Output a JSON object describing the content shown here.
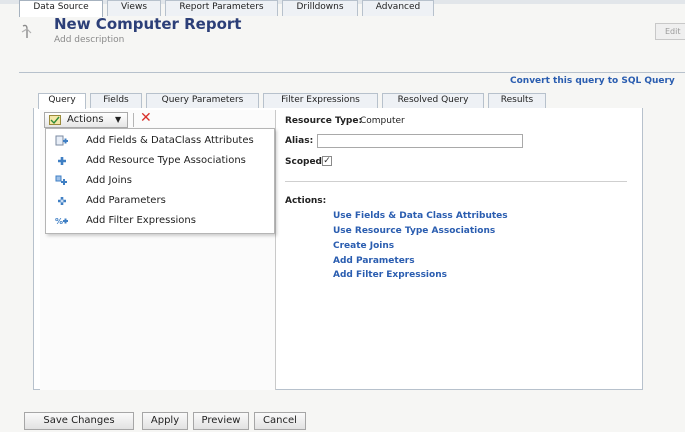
{
  "header": {
    "title": "New Computer Report",
    "description_placeholder": "Add description",
    "edit_label": "Edit"
  },
  "outer_tabs": [
    {
      "label": "Data Source",
      "active": true
    },
    {
      "label": "Views",
      "active": false
    },
    {
      "label": "Report Parameters",
      "active": false
    },
    {
      "label": "Drilldowns",
      "active": false
    },
    {
      "label": "Advanced",
      "active": false
    }
  ],
  "convert_link": "Convert this query to SQL Query",
  "inner_tabs": [
    {
      "label": "Query",
      "active": true
    },
    {
      "label": "Fields",
      "active": false
    },
    {
      "label": "Query Parameters",
      "active": false
    },
    {
      "label": "Filter Expressions",
      "active": false
    },
    {
      "label": "Resolved Query",
      "active": false
    },
    {
      "label": "Results",
      "active": false
    }
  ],
  "toolbar": {
    "actions_label": "Actions",
    "actions_icon": "actions-icon",
    "delete_icon": "delete-x-icon"
  },
  "actions_menu": [
    {
      "label": "Add Fields & DataClass Attributes",
      "icon": "fields-icon"
    },
    {
      "label": "Add Resource Type Associations",
      "icon": "association-icon"
    },
    {
      "label": "Add Joins",
      "icon": "joins-icon"
    },
    {
      "label": "Add Parameters",
      "icon": "parameters-icon"
    },
    {
      "label": "Add Filter Expressions",
      "icon": "filter-icon"
    }
  ],
  "details": {
    "resource_type_label": "Resource Type:",
    "resource_type_value": "Computer",
    "alias_label": "Alias:",
    "alias_value": "",
    "scoped_label": "Scoped:",
    "scoped_checked": true,
    "actions_heading": "Actions:",
    "action_links": [
      "Use Fields & Data Class Attributes",
      "Use Resource Type Associations",
      "Create Joins",
      "Add Parameters",
      "Add Filter Expressions"
    ]
  },
  "footer": {
    "save_label": "Save Changes",
    "apply_label": "Apply",
    "preview_label": "Preview",
    "cancel_label": "Cancel"
  },
  "colors": {
    "title": "#2c3f78",
    "link": "#2a5db0",
    "delete": "#d8312b",
    "icon_blue": "#3f7fc4"
  }
}
